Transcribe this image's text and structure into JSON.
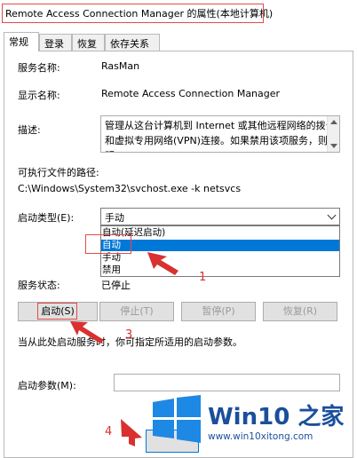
{
  "window": {
    "title": "Remote Access Connection Manager 的属性(本地计算机)"
  },
  "tabs": [
    {
      "label": "常规",
      "active": true
    },
    {
      "label": "登录",
      "active": false
    },
    {
      "label": "恢复",
      "active": false
    },
    {
      "label": "依存关系",
      "active": false
    }
  ],
  "general": {
    "service_name_label": "服务名称:",
    "service_name_value": "RasMan",
    "display_name_label": "显示名称:",
    "display_name_value": "Remote Access Connection Manager",
    "description_label": "描述:",
    "description_line1": "管理从这台计算机到 Internet 或其他远程网络的拨号",
    "description_line2": "和虚拟专用网络(VPN)连接。如果禁用该项服务，则明",
    "exe_path_label": "可执行文件的路径:",
    "exe_path_value": "C:\\Windows\\System32\\svchost.exe -k netsvcs",
    "startup_type_label": "启动类型(E):",
    "startup_type_value": "手动",
    "startup_options": [
      "自动(延迟启动)",
      "自动",
      "手动",
      "禁用"
    ],
    "startup_selected": "自动",
    "service_status_label": "服务状态:",
    "service_status_value": "已停止",
    "buttons": {
      "start": "启动(S)",
      "stop": "停止(T)",
      "pause": "暂停(P)",
      "resume": "恢复(R)"
    },
    "hint_text": "当从此处启动服务时，你可指定所适用的启动参数。",
    "start_params_label": "启动参数(M):"
  },
  "annotations": {
    "step1": "1",
    "step3": "3",
    "step4": "4",
    "color": "#d9312f"
  },
  "watermark": {
    "brand": "Win10 之家",
    "url": "www.win10xitong.com",
    "color": "#1a4f9c"
  }
}
